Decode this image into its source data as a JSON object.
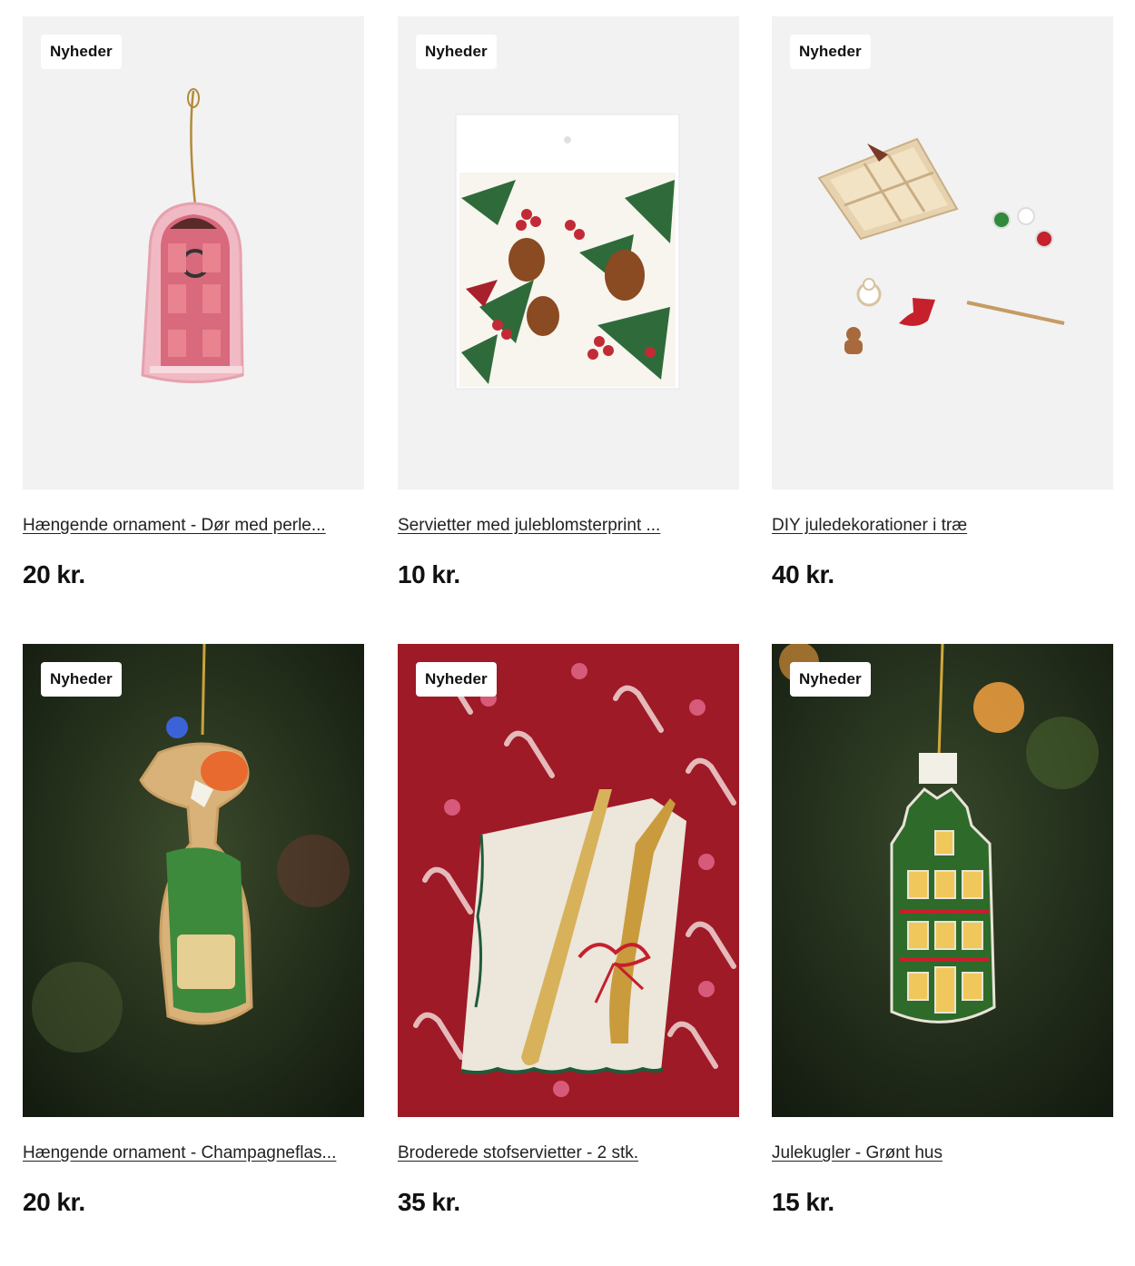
{
  "products": [
    {
      "badge": "Nyheder",
      "title": "Hængende ornament - Dør med perle...",
      "price": "20 kr."
    },
    {
      "badge": "Nyheder",
      "title": "Servietter med juleblomsterprint ...",
      "price": "10 kr."
    },
    {
      "badge": "Nyheder",
      "title": "DIY juledekorationer i træ",
      "price": "40 kr."
    },
    {
      "badge": "Nyheder",
      "title": "Hængende ornament - Champagneflas...",
      "price": "20 kr."
    },
    {
      "badge": "Nyheder",
      "title": "Broderede stofservietter - 2 stk.",
      "price": "35 kr."
    },
    {
      "badge": "Nyheder",
      "title": "Julekugler - Grønt hus",
      "price": "15 kr."
    }
  ],
  "images": {
    "p0": "ornament-pink-door",
    "p1": "napkins-christmas-floral",
    "p2": "diy-wooden-decorations",
    "p3": "ornament-champagne-bottle",
    "p4": "embroidered-napkins-cutlery",
    "p5": "ornament-green-house"
  },
  "colors": {
    "product_bg": "#f2f2f2",
    "tree_dark": "#1f2a17",
    "tablecloth_red": "#9e1a26"
  }
}
